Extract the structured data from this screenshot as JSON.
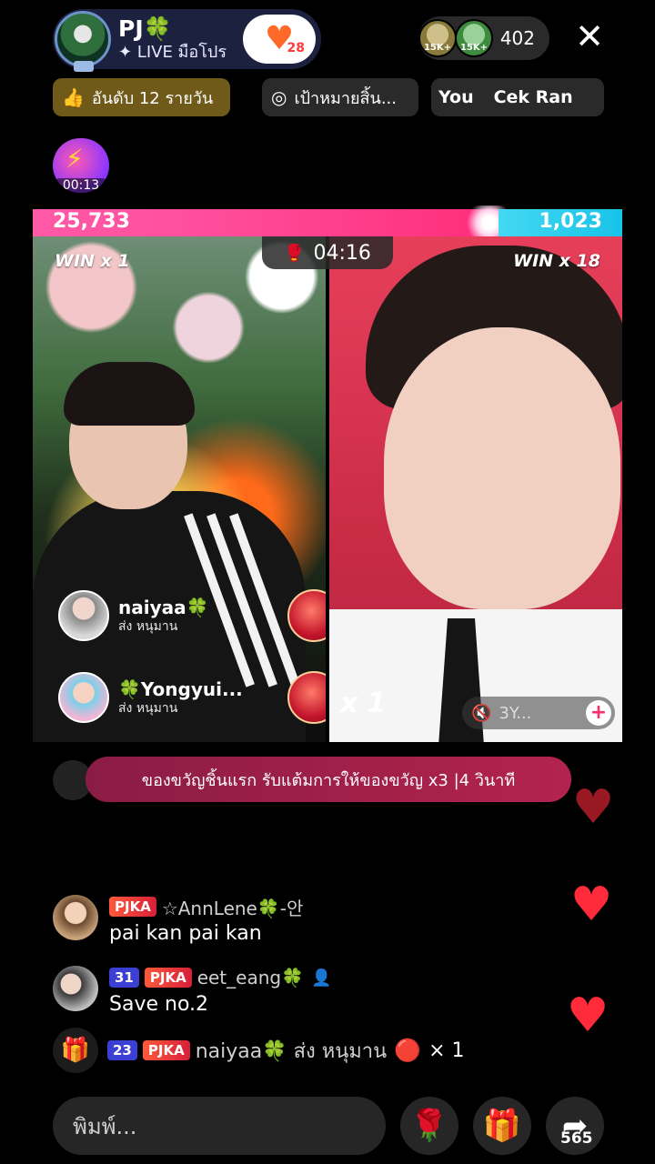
{
  "host": {
    "name": "PJ🍀",
    "subtitle": "✦ LIVE มือโปร",
    "follow_count": "28"
  },
  "viewers": {
    "badge1": "15K+",
    "badge2": "15K+",
    "count": "402"
  },
  "chips": {
    "rank": "อันดับ 12 รายวัน",
    "target": "เป้าหมายสิ้น...",
    "scroll_1": "You",
    "scroll_2": "Cek Ran"
  },
  "timer_badge": "00:13",
  "battle": {
    "left_score": "25,733",
    "right_score": "1,023",
    "left_win": "WIN x 1",
    "right_win": "WIN x 18",
    "timer": "04:16",
    "x_left": "x 1",
    "x_right": "x 1",
    "mute_label": "3Y..."
  },
  "supporters": [
    {
      "name": "naiyaa🍀",
      "gift": "ส่ง หนุมาน"
    },
    {
      "name": "🍀Yongyui...",
      "gift": "ส่ง หนุมาน"
    }
  ],
  "banner": "ของขวัญชิ้นแรก รับแต้มการให้ของขวัญ x3  |4 วินาที",
  "chat": [
    {
      "badge": "PJKA",
      "user": "☆AnnLene🍀-안",
      "message": "pai kan pai kan"
    },
    {
      "level": "31",
      "badge": "PJKA",
      "user": "eet_eang🍀",
      "message": "Save no.2"
    }
  ],
  "gift_line": {
    "level": "23",
    "badge": "PJKA",
    "text": "naiyaa🍀 ส่ง หนุมาน",
    "count": "× 1"
  },
  "input": {
    "placeholder": "พิมพ์..."
  },
  "share_count": "565",
  "colors": {
    "accent_pink": "#ff2d7a",
    "accent_cyan": "#18c3e8",
    "heart_red": "#ff2a3a",
    "banner": "#a5214c"
  },
  "icons": [
    "thumbs-up-icon",
    "target-icon",
    "close-icon",
    "bolt-icon",
    "boxing-glove-icon",
    "gift-box-icon",
    "rose-icon",
    "gift-icon",
    "share-icon",
    "heart-icon",
    "mute-icon",
    "plus-icon",
    "profile-icon"
  ]
}
